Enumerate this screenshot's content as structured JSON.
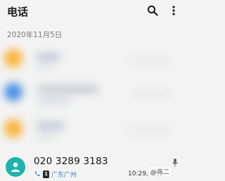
{
  "app": {
    "title": "电话"
  },
  "toolbar": {
    "search_icon": "search-icon",
    "more_icon": "more-vert-icon"
  },
  "date_header": "2020年11月5日",
  "colors": {
    "background": "#f3f3f3",
    "avatar_orange": "#f9b33a",
    "avatar_blue": "#4a90e2",
    "accent_teal": "#1fb3ad",
    "location_blue": "#3a7fd6"
  },
  "call": {
    "number": "020 3289 3183",
    "sim": "1",
    "location": "广东广州",
    "time": "10:29, 0 分",
    "watermark": "@鸟二"
  }
}
